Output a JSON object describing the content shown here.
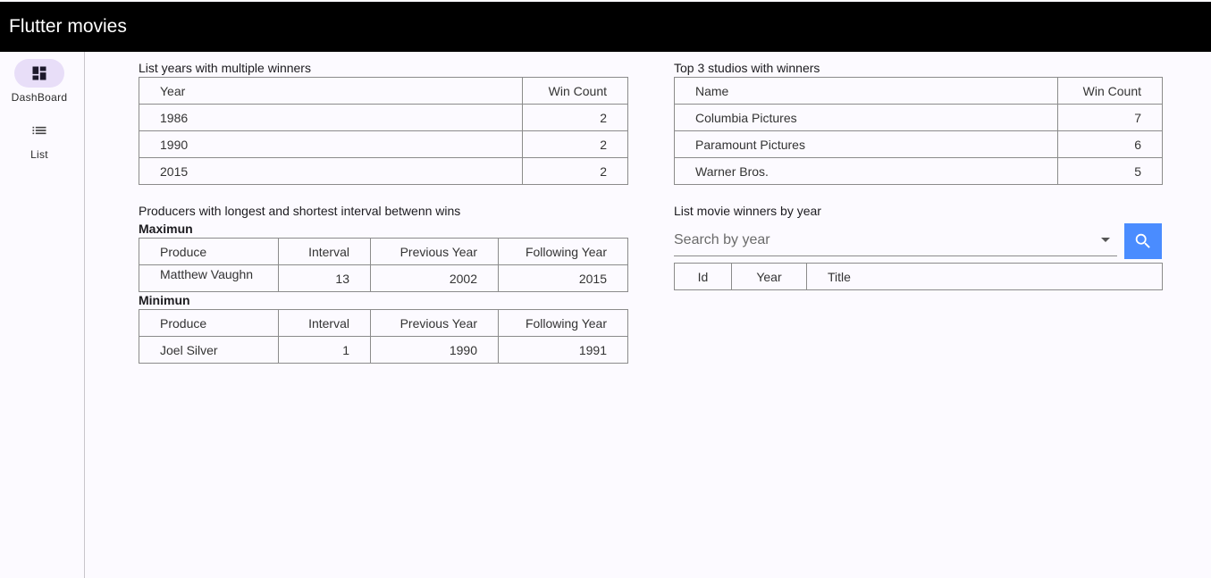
{
  "app": {
    "title": "Flutter movies"
  },
  "nav": {
    "items": [
      {
        "label": "DashBoard",
        "icon": "dashboard-icon",
        "active": true
      },
      {
        "label": "List",
        "icon": "list-icon",
        "active": false
      }
    ]
  },
  "multiple_winners": {
    "title": "List years with multiple winners",
    "headers": [
      "Year",
      "Win Count"
    ],
    "rows": [
      [
        "1986",
        "2"
      ],
      [
        "1990",
        "2"
      ],
      [
        "2015",
        "2"
      ]
    ]
  },
  "top_studios": {
    "title": "Top 3 studios with winners",
    "headers": [
      "Name",
      "Win Count"
    ],
    "rows": [
      [
        "Columbia Pictures",
        "7"
      ],
      [
        "Paramount Pictures",
        "6"
      ],
      [
        "Warner Bros.",
        "5"
      ]
    ]
  },
  "intervals": {
    "title": "Producers with longest and shortest interval betwenn wins",
    "max_label": "Maximun",
    "min_label": "Minimun",
    "headers": [
      "Produce",
      "Interval",
      "Previous Year",
      "Following Year"
    ],
    "max_rows": [
      [
        "Matthew Vaughn",
        "13",
        "2002",
        "2015"
      ]
    ],
    "min_rows": [
      [
        "Joel Silver",
        "1",
        "1990",
        "1991"
      ]
    ]
  },
  "winners_by_year": {
    "title": "List movie winners by year",
    "search_placeholder": "Search by year",
    "search_value": "",
    "headers": [
      "Id",
      "Year",
      "Title"
    ]
  },
  "colors": {
    "appbar": "#000000",
    "active_pill": "#e8def8",
    "search_button": "#4a8cff"
  }
}
